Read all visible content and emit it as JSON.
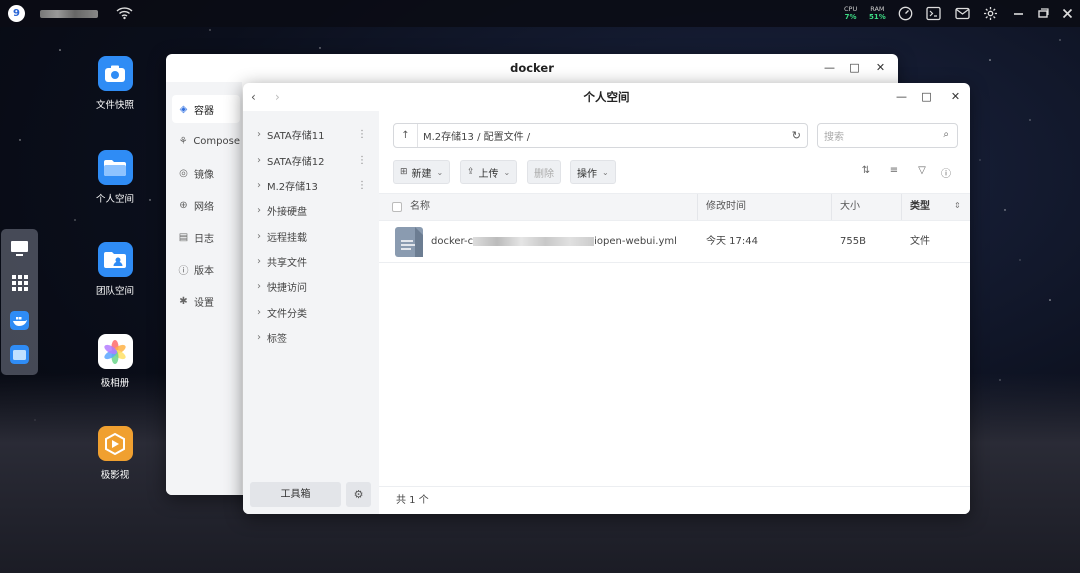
{
  "topbar": {
    "logo": "9",
    "cpu_label": "CPU",
    "cpu_value": "7%",
    "ram_label": "RAM",
    "ram_value": "51%",
    "icons": [
      "wifi-icon",
      "gauge-icon",
      "terminal-icon",
      "mail-icon",
      "gear-icon",
      "minimize-icon",
      "restore-icon",
      "close-icon"
    ]
  },
  "desktop": {
    "icons": [
      {
        "label": "文件快照",
        "color": "#2f8cf5"
      },
      {
        "label": "个人空间",
        "color": "#2f8cf5"
      },
      {
        "label": "团队空间",
        "color": "#2f8cf5"
      },
      {
        "label": "极相册",
        "color": "#ffffff"
      },
      {
        "label": "极影视",
        "color": "#f0a030"
      }
    ]
  },
  "docker_window": {
    "title": "docker",
    "nav": [
      {
        "label": "容器",
        "icon": "layers-icon"
      },
      {
        "label": "Compose",
        "icon": "compose-icon"
      },
      {
        "label": "镜像",
        "icon": "image-icon"
      },
      {
        "label": "网络",
        "icon": "globe-icon"
      },
      {
        "label": "日志",
        "icon": "log-icon"
      },
      {
        "label": "版本",
        "icon": "info-icon"
      },
      {
        "label": "设置",
        "icon": "gear-icon"
      }
    ]
  },
  "files_window": {
    "title": "个人空间",
    "sidebar": [
      {
        "label": "SATA存储11",
        "more": true
      },
      {
        "label": "SATA存储12",
        "more": true
      },
      {
        "label": "M.2存储13",
        "more": true
      },
      {
        "label": "外接硬盘",
        "more": false
      },
      {
        "label": "远程挂载",
        "more": false
      },
      {
        "label": "共享文件",
        "more": false
      },
      {
        "label": "快捷访问",
        "more": false
      },
      {
        "label": "文件分类",
        "more": false
      },
      {
        "label": "标签",
        "more": false
      }
    ],
    "toolbox_label": "工具箱",
    "path": "M.2存储13 / 配置文件 /",
    "search_placeholder": "搜索",
    "buttons": {
      "new": "新建",
      "upload": "上传",
      "delete": "删除",
      "action": "操作"
    },
    "columns": {
      "name": "名称",
      "modified": "修改时间",
      "size": "大小",
      "type": "类型"
    },
    "files": [
      {
        "name_prefix": "docker-c",
        "name_suffix": "iopen-webui.yml",
        "modified": "今天 17:44",
        "size": "755B",
        "type": "文件"
      }
    ],
    "footer": "共 1 个"
  }
}
